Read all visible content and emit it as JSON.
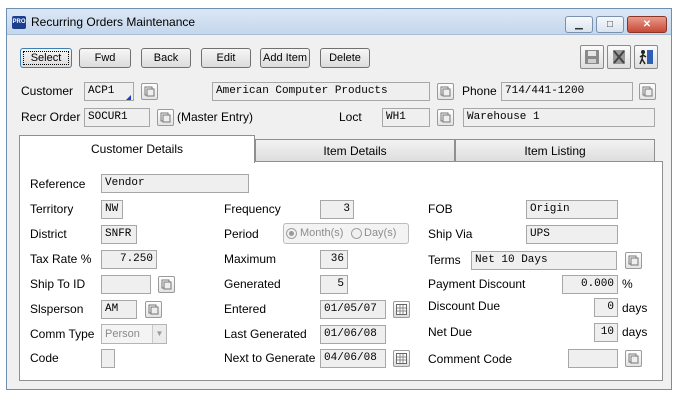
{
  "window": {
    "app_badge": "PRO",
    "title": "Recurring Orders Maintenance",
    "min_glyph": "▁",
    "max_glyph": "□",
    "close_glyph": "✕"
  },
  "toolbar": {
    "select": "Select",
    "fwd": "Fwd",
    "back": "Back",
    "edit": "Edit",
    "add_item": "Add Item",
    "delete": "Delete"
  },
  "header": {
    "customer_label": "Customer",
    "customer_no": "ACP1",
    "customer_name": "American Computer Products",
    "phone_label": "Phone",
    "phone": "714/441-1200",
    "recr_order_label": "Recr Order",
    "recr_order": "SOCUR1",
    "master_entry": "(Master Entry)",
    "loct_label": "Loct",
    "loct": "WH1",
    "loct_name": "Warehouse 1"
  },
  "tabs": [
    "Customer Details",
    "Item Details",
    "Item Listing"
  ],
  "details": {
    "reference_label": "Reference",
    "reference": "Vendor",
    "territory_label": "Territory",
    "territory": "NW",
    "district_label": "District",
    "district": "SNFR",
    "tax_rate_label": "Tax Rate %",
    "tax_rate": "7.250",
    "ship_to_label": "Ship To ID",
    "ship_to": "",
    "slsperson_label": "Slsperson",
    "slsperson": "AM",
    "comm_type_label": "Comm Type",
    "comm_type": "Person",
    "code_label": "Code",
    "code": "",
    "frequency_label": "Frequency",
    "frequency": "3",
    "period_label": "Period",
    "period_options": [
      "Month(s)",
      "Day(s)"
    ],
    "period_selected": "Month(s)",
    "maximum_label": "Maximum",
    "maximum": "36",
    "generated_label": "Generated",
    "generated": "5",
    "entered_label": "Entered",
    "entered": "01/05/07",
    "last_generated_label": "Last Generated",
    "last_generated": "01/06/08",
    "next_generate_label": "Next to Generate",
    "next_generate": "04/06/08",
    "fob_label": "FOB",
    "fob": "Origin",
    "ship_via_label": "Ship Via",
    "ship_via": "UPS",
    "terms_label": "Terms",
    "terms": "Net 10 Days",
    "payment_discount_label": "Payment Discount",
    "payment_discount": "0.000",
    "percent_sign": "%",
    "discount_due_label": "Discount Due",
    "discount_due": "0",
    "net_due_label": "Net Due",
    "net_due": "10",
    "days_unit": "days",
    "comment_code_label": "Comment Code",
    "comment_code": ""
  },
  "icons": {
    "lookup": "lookup-icon",
    "calendar": "calendar-icon",
    "save": "save-icon",
    "delete_record": "delete-record-icon",
    "exit": "exit-icon"
  }
}
